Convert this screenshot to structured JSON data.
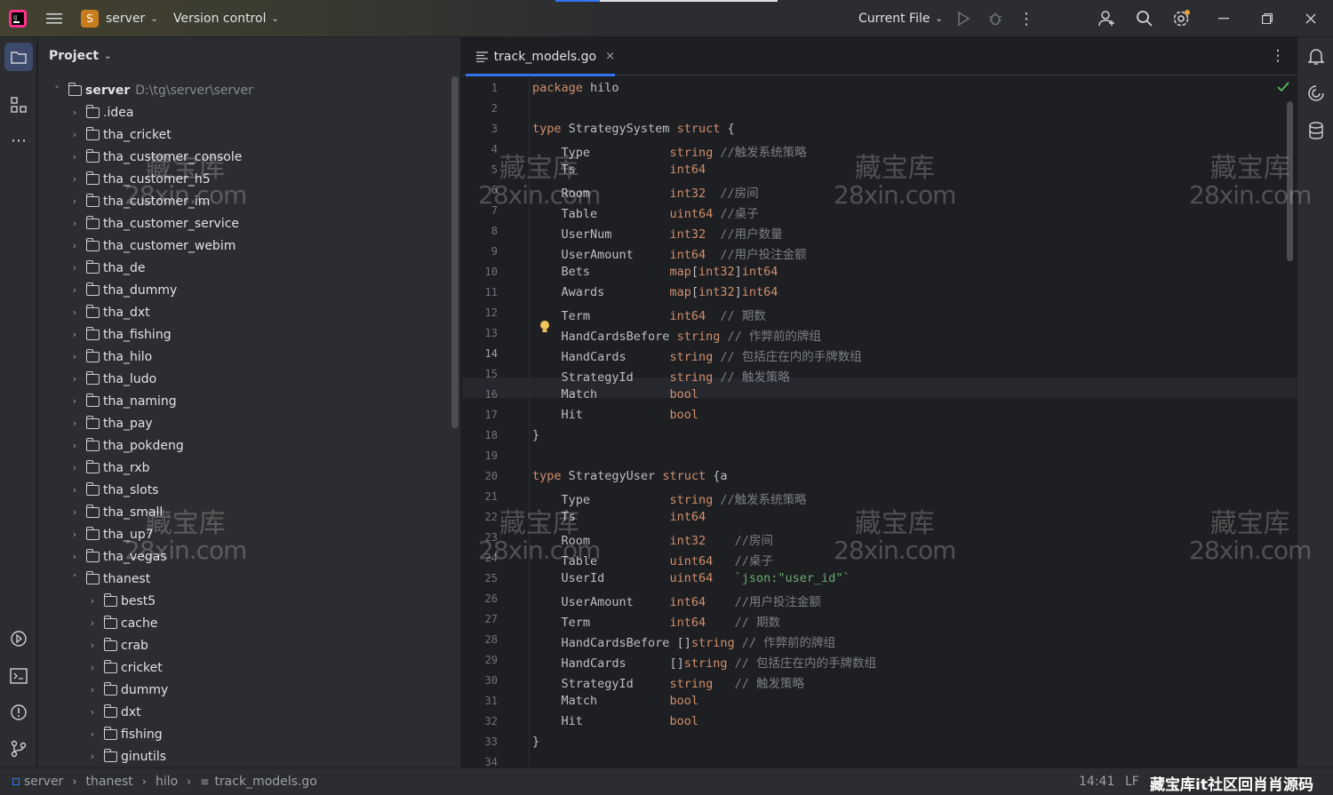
{
  "titlebar": {
    "project_badge": "S",
    "project_name": "server",
    "vcs": "Version control",
    "run_config": "Current File"
  },
  "project_panel": {
    "title": "Project",
    "root": {
      "name": "server",
      "path": "D:\\tg\\server\\server"
    },
    "items": [
      ".idea",
      "tha_cricket",
      "tha_customer_console",
      "tha_customer_h5",
      "tha_customer_im",
      "tha_customer_service",
      "tha_customer_webim",
      "tha_de",
      "tha_dummy",
      "tha_dxt",
      "tha_fishing",
      "tha_hilo",
      "tha_ludo",
      "tha_naming",
      "tha_pay",
      "tha_pokdeng",
      "tha_rxb",
      "tha_slots",
      "tha_small",
      "tha_up7",
      "tha_vegas",
      "thanest"
    ],
    "sub_items": [
      "best5",
      "cache",
      "crab",
      "cricket",
      "dummy",
      "dxt",
      "fishing",
      "ginutils"
    ]
  },
  "editor": {
    "tab": "track_models.go",
    "current_line": 14
  },
  "code_lines": [
    [
      [
        "kw",
        "package "
      ],
      [
        "p",
        "hilo"
      ]
    ],
    [],
    [
      [
        "kw",
        "type "
      ],
      [
        "p",
        "StrategySystem "
      ],
      [
        "kw",
        "struct "
      ],
      [
        "p",
        "{"
      ]
    ],
    [
      [
        "p",
        "    Type           "
      ],
      [
        "ty",
        "string "
      ],
      [
        "cm",
        "//触发系统策略"
      ]
    ],
    [
      [
        "p",
        "    Ts             "
      ],
      [
        "ty",
        "int64"
      ]
    ],
    [
      [
        "p",
        "    Room           "
      ],
      [
        "ty",
        "int32  "
      ],
      [
        "cm",
        "//房间"
      ]
    ],
    [
      [
        "p",
        "    Table          "
      ],
      [
        "ty",
        "uint64 "
      ],
      [
        "cm",
        "//桌子"
      ]
    ],
    [
      [
        "p",
        "    UserNum        "
      ],
      [
        "ty",
        "int32  "
      ],
      [
        "cm",
        "//用户数量"
      ]
    ],
    [
      [
        "p",
        "    UserAmount     "
      ],
      [
        "ty",
        "int64  "
      ],
      [
        "cm",
        "//用户投注金额"
      ]
    ],
    [
      [
        "p",
        "    Bets           "
      ],
      [
        "ty",
        "map"
      ],
      [
        "p",
        "["
      ],
      [
        "ty",
        "int32"
      ],
      [
        "p",
        "]"
      ],
      [
        "ty",
        "int64"
      ]
    ],
    [
      [
        "p",
        "    Awards         "
      ],
      [
        "ty",
        "map"
      ],
      [
        "p",
        "["
      ],
      [
        "ty",
        "int32"
      ],
      [
        "p",
        "]"
      ],
      [
        "ty",
        "int64"
      ]
    ],
    [
      [
        "p",
        "    Term           "
      ],
      [
        "ty",
        "int64  "
      ],
      [
        "cm",
        "// 期数"
      ]
    ],
    [
      [
        "p",
        "    HandCardsBefore "
      ],
      [
        "ty",
        "string "
      ],
      [
        "cm",
        "// 作弊前的牌组"
      ]
    ],
    [
      [
        "p",
        "    HandCards      "
      ],
      [
        "ty",
        "string "
      ],
      [
        "cm",
        "// 包括庄在内的手牌数组"
      ]
    ],
    [
      [
        "p",
        "    StrategyId     "
      ],
      [
        "ty",
        "string "
      ],
      [
        "cm",
        "// 触发策略"
      ]
    ],
    [
      [
        "p",
        "    Match          "
      ],
      [
        "ty",
        "bool"
      ]
    ],
    [
      [
        "p",
        "    Hit            "
      ],
      [
        "ty",
        "bool"
      ]
    ],
    [
      [
        "p",
        "}"
      ]
    ],
    [],
    [
      [
        "kw",
        "type "
      ],
      [
        "p",
        "StrategyUser "
      ],
      [
        "kw",
        "struct "
      ],
      [
        "p",
        "{a"
      ]
    ],
    [
      [
        "p",
        "    Type           "
      ],
      [
        "ty",
        "string "
      ],
      [
        "cm",
        "//触发系统策略"
      ]
    ],
    [
      [
        "p",
        "    Ts             "
      ],
      [
        "ty",
        "int64"
      ]
    ],
    [
      [
        "p",
        "    Room           "
      ],
      [
        "ty",
        "int32    "
      ],
      [
        "cm",
        "//房间"
      ]
    ],
    [
      [
        "p",
        "    Table          "
      ],
      [
        "ty",
        "uint64   "
      ],
      [
        "cm",
        "//桌子"
      ]
    ],
    [
      [
        "p",
        "    UserId         "
      ],
      [
        "ty",
        "uint64   "
      ],
      [
        "st",
        "`json:\"user_id\"`"
      ]
    ],
    [
      [
        "p",
        "    UserAmount     "
      ],
      [
        "ty",
        "int64    "
      ],
      [
        "cm",
        "//用户投注金额"
      ]
    ],
    [
      [
        "p",
        "    Term           "
      ],
      [
        "ty",
        "int64    "
      ],
      [
        "cm",
        "// 期数"
      ]
    ],
    [
      [
        "p",
        "    HandCardsBefore "
      ],
      [
        "p",
        "[]"
      ],
      [
        "ty",
        "string "
      ],
      [
        "cm",
        "// 作弊前的牌组"
      ]
    ],
    [
      [
        "p",
        "    HandCards      "
      ],
      [
        "p",
        "[]"
      ],
      [
        "ty",
        "string "
      ],
      [
        "cm",
        "// 包括庄在内的手牌数组"
      ]
    ],
    [
      [
        "p",
        "    StrategyId     "
      ],
      [
        "ty",
        "string   "
      ],
      [
        "cm",
        "// 触发策略"
      ]
    ],
    [
      [
        "p",
        "    Match          "
      ],
      [
        "ty",
        "bool"
      ]
    ],
    [
      [
        "p",
        "    Hit            "
      ],
      [
        "ty",
        "bool"
      ]
    ],
    [
      [
        "p",
        "}"
      ]
    ],
    []
  ],
  "status": {
    "crumbs": [
      "server",
      "thanest",
      "hilo",
      "track_models.go"
    ],
    "position": "14:41",
    "line_sep": "LF",
    "footer_brand": "藏宝库it社区回肖肖源码"
  },
  "watermark": {
    "line1": "藏宝库",
    "line2": "28xin.com"
  },
  "colors": {
    "accent": "#3574f0",
    "keyword": "#cf8e6d",
    "comment": "#7a7e85",
    "string": "#6aab73"
  }
}
